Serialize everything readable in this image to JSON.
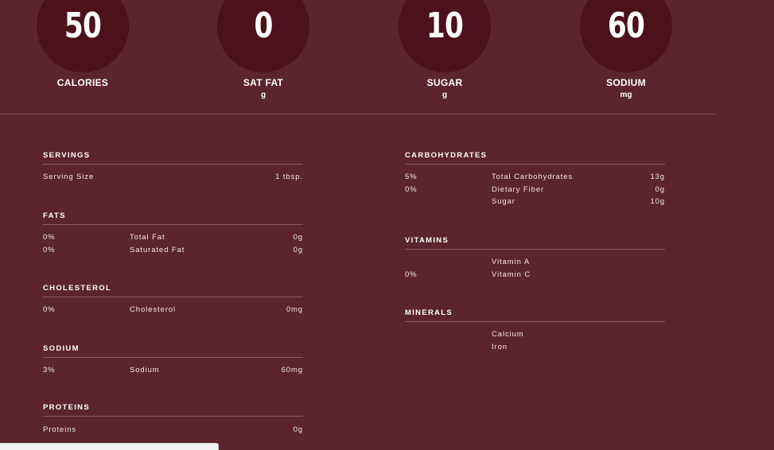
{
  "stats": [
    {
      "value": "50",
      "label": "CALORIES",
      "unit": ""
    },
    {
      "value": "0",
      "label": "SAT FAT",
      "unit": "g"
    },
    {
      "value": "10",
      "label": "SUGAR",
      "unit": "g"
    },
    {
      "value": "60",
      "label": "SODIUM",
      "unit": "mg"
    }
  ],
  "left": {
    "servings": {
      "title": "SERVINGS",
      "rows": [
        {
          "pct": "",
          "name": "Serving Size",
          "amount": "1 tbsp."
        }
      ]
    },
    "fats": {
      "title": "FATS",
      "rows": [
        {
          "pct": "0%",
          "name": "Total Fat",
          "amount": "0g"
        },
        {
          "pct": "0%",
          "name": "Saturated Fat",
          "amount": "0g"
        }
      ]
    },
    "cholesterol": {
      "title": "CHOLESTEROL",
      "rows": [
        {
          "pct": "0%",
          "name": "Cholesterol",
          "amount": "0mg"
        }
      ]
    },
    "sodium": {
      "title": "SODIUM",
      "rows": [
        {
          "pct": "3%",
          "name": "Sodium",
          "amount": "60mg"
        }
      ]
    },
    "proteins": {
      "title": "PROTEINS",
      "rows": [
        {
          "pct": "",
          "name": "Proteins",
          "amount": "0g"
        }
      ]
    }
  },
  "right": {
    "carbohydrates": {
      "title": "CARBOHYDRATES",
      "rows": [
        {
          "pct": "5%",
          "name": "Total Carbohydrates",
          "amount": "13g"
        },
        {
          "pct": "0%",
          "name": "Dietary Fiber",
          "amount": "0g"
        },
        {
          "pct": "",
          "name": "Sugar",
          "amount": "10g"
        }
      ]
    },
    "vitamins": {
      "title": "VITAMINS",
      "rows": [
        {
          "pct": "",
          "name": "Vitamin A",
          "amount": ""
        },
        {
          "pct": "0%",
          "name": "Vitamin C",
          "amount": ""
        }
      ]
    },
    "minerals": {
      "title": "MINERALS",
      "rows": [
        {
          "pct": "",
          "name": "Calcium",
          "amount": ""
        },
        {
          "pct": "",
          "name": "Iron",
          "amount": ""
        }
      ]
    }
  },
  "colors": {
    "background": "#5c242d",
    "circle": "#4c111b",
    "text": "#ffffff"
  }
}
